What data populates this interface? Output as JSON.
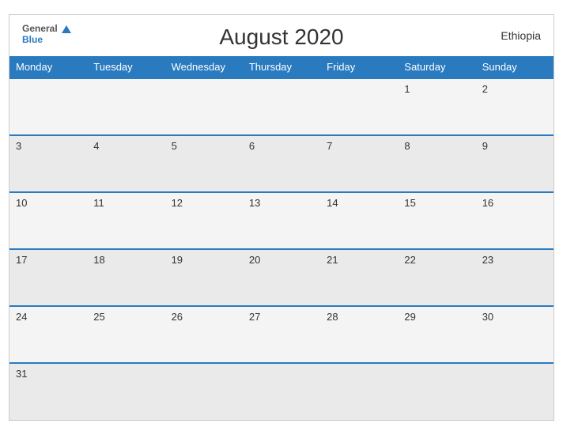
{
  "header": {
    "title": "August 2020",
    "country": "Ethiopia",
    "logo_general": "General",
    "logo_blue": "Blue"
  },
  "weekdays": [
    "Monday",
    "Tuesday",
    "Wednesday",
    "Thursday",
    "Friday",
    "Saturday",
    "Sunday"
  ],
  "weeks": [
    [
      null,
      null,
      null,
      null,
      null,
      "1",
      "2"
    ],
    [
      "3",
      "4",
      "5",
      "6",
      "7",
      "8",
      "9"
    ],
    [
      "10",
      "11",
      "12",
      "13",
      "14",
      "15",
      "16"
    ],
    [
      "17",
      "18",
      "19",
      "20",
      "21",
      "22",
      "23"
    ],
    [
      "24",
      "25",
      "26",
      "27",
      "28",
      "29",
      "30"
    ],
    [
      "31",
      null,
      null,
      null,
      null,
      null,
      null
    ]
  ]
}
